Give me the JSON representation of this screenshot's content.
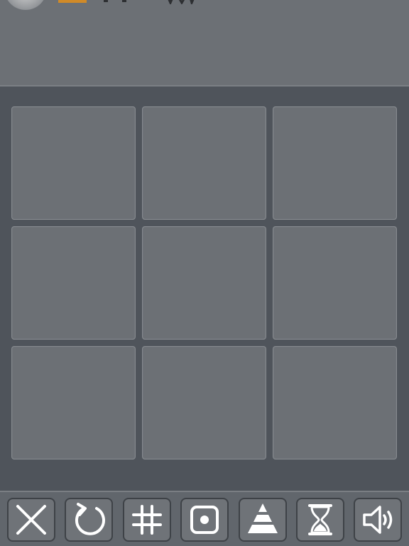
{
  "header": {
    "avatar_icon": "player-avatar",
    "badge_color": "#d08a28",
    "rating_icon": "star-icon"
  },
  "board": {
    "rows": 3,
    "cols": 3,
    "cells": [
      "",
      "",
      "",
      "",
      "",
      "",
      "",
      "",
      ""
    ]
  },
  "toolbar": {
    "buttons": [
      {
        "icon": "close-icon"
      },
      {
        "icon": "restart-icon"
      },
      {
        "icon": "grid-icon"
      },
      {
        "icon": "target-icon"
      },
      {
        "icon": "pyramid-icon"
      },
      {
        "icon": "hourglass-icon"
      },
      {
        "icon": "sound-icon"
      }
    ]
  },
  "colors": {
    "background": "#4f545b",
    "panel": "#6c7075",
    "cell_border": "#868a8f",
    "icon": "#ffffff"
  }
}
